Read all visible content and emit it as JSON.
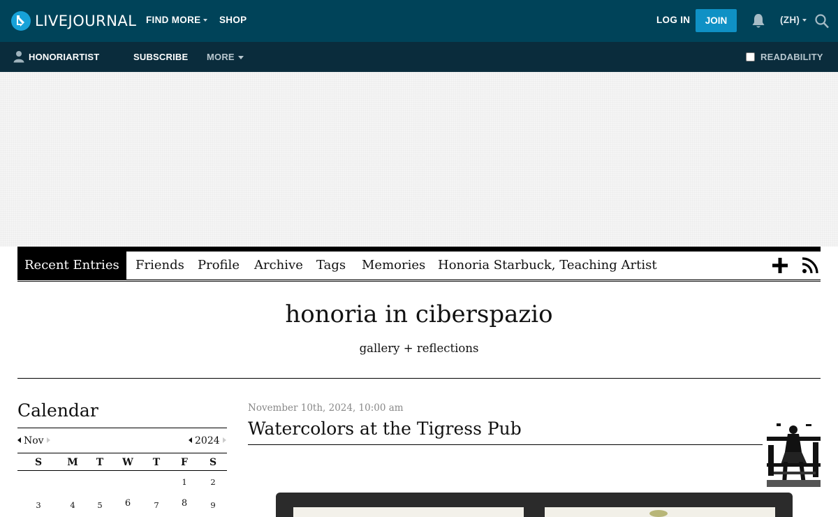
{
  "topbar": {
    "logo_text": "LIVEJOURNAL",
    "find_more": "FIND MORE",
    "shop": "SHOP",
    "log_in": "LOG IN",
    "join": "JOIN",
    "language": "(ZH)"
  },
  "subbar": {
    "username": "HONORIARTIST",
    "subscribe": "SUBSCRIBE",
    "more": "MORE",
    "readability": "READABILITY"
  },
  "journal_nav": {
    "tabs": [
      "Recent Entries",
      "Friends",
      "Profile",
      "Archive",
      "Tags",
      "Memories",
      "Honoria Starbuck, Teaching Artist"
    ]
  },
  "journal": {
    "title": "honoria in ciberspazio",
    "subtitle": "gallery + reflections"
  },
  "calendar": {
    "heading": "Calendar",
    "month": "Nov",
    "year": "2024",
    "weekdays": [
      "S",
      "M",
      "T",
      "W",
      "T",
      "F",
      "S"
    ],
    "week1": [
      "",
      "",
      "",
      "",
      "",
      "1",
      "2"
    ],
    "week2": [
      "3",
      "4",
      "5",
      "6",
      "7",
      "8",
      "9"
    ]
  },
  "entry": {
    "date": "November 10th, 2024, 10:00 am",
    "title": "Watercolors at the Tigress Pub"
  },
  "colors": {
    "topbar_bg": "#004359",
    "subbar_bg": "#0a2c3c",
    "join_button": "#0f91c5"
  }
}
